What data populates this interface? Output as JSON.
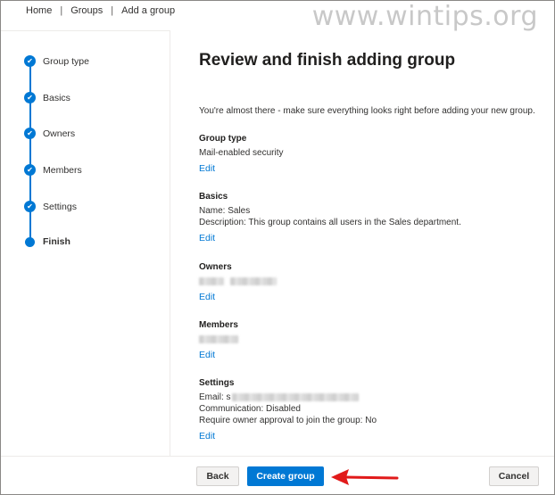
{
  "breadcrumb": [
    "Home",
    "Groups",
    "Add a group"
  ],
  "watermark": "www.wintips.org",
  "steps": [
    {
      "label": "Group type",
      "status": "complete"
    },
    {
      "label": "Basics",
      "status": "complete"
    },
    {
      "label": "Owners",
      "status": "complete"
    },
    {
      "label": "Members",
      "status": "complete"
    },
    {
      "label": "Settings",
      "status": "complete"
    },
    {
      "label": "Finish",
      "status": "current"
    }
  ],
  "main": {
    "title": "Review and finish adding group",
    "intro": "You're almost there - make sure everything looks right before adding your new group.",
    "edit_label": "Edit",
    "sections": {
      "group_type": {
        "title": "Group type",
        "value": "Mail-enabled security"
      },
      "basics": {
        "title": "Basics",
        "name": "Name: Sales",
        "description": "Description: This group contains all users in the Sales department."
      },
      "owners": {
        "title": "Owners"
      },
      "members": {
        "title": "Members"
      },
      "settings": {
        "title": "Settings",
        "email_label": "Email: s",
        "communication": "Communication: Disabled",
        "approval": "Require owner approval to join the group: No"
      }
    }
  },
  "footer": {
    "back_label": "Back",
    "create_label": "Create group",
    "cancel_label": "Cancel"
  },
  "colors": {
    "accent": "#0078d4",
    "annotation_arrow": "#e11a1a"
  },
  "icons": {
    "step_complete": "checkmark-icon",
    "annotation": "red-arrow-icon"
  }
}
